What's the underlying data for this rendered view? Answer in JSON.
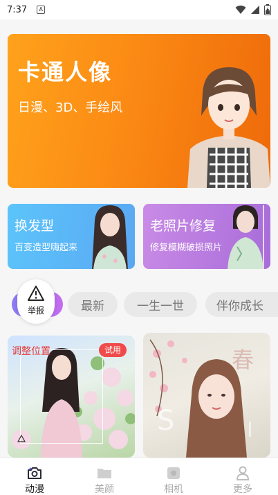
{
  "status_bar": {
    "time": "7:37",
    "notification_glyph": "A"
  },
  "hero": {
    "title": "卡通人像",
    "subtitle": "日漫、3D、手绘风"
  },
  "features": [
    {
      "title": "换发型",
      "subtitle": "百变造型嗨起来"
    },
    {
      "title": "老照片修复",
      "subtitle": "修复模糊破损照片"
    }
  ],
  "report": {
    "label": "举报"
  },
  "categories": [
    {
      "label": "最新"
    },
    {
      "label": "一生一世"
    },
    {
      "label": "伴你成长"
    }
  ],
  "gallery": {
    "left": {
      "adjust_label": "调整位置",
      "badge": "试用"
    },
    "right": {}
  },
  "bottom_nav": [
    {
      "label": "动漫",
      "icon": "camera-icon",
      "active": true
    },
    {
      "label": "美颜",
      "icon": "folder-icon",
      "active": false
    },
    {
      "label": "相机",
      "icon": "square-camera-icon",
      "active": false
    },
    {
      "label": "更多",
      "icon": "person-icon",
      "active": false
    }
  ],
  "colors": {
    "hero_orange": "#f98a14",
    "card_blue": "#5ab4f6",
    "card_purple": "#b67ae0",
    "chip_active_gradient_start": "#8a7cf5",
    "badge_red": "#f04a4a"
  }
}
